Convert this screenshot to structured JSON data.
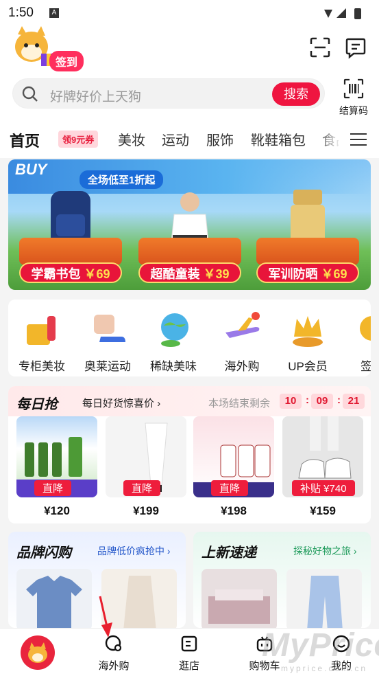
{
  "status": {
    "time": "1:50",
    "notif_letter": "A"
  },
  "header": {
    "signin_label": "签到",
    "search_placeholder": "好牌好价上天狗",
    "search_button": "搜索",
    "settle_label": "结算码"
  },
  "tabs": {
    "active": "首页",
    "coupon": "领9元券",
    "items": [
      "美妆",
      "运动",
      "服饰",
      "靴鞋箱包",
      "食品"
    ]
  },
  "banner": {
    "top_text": "BUY",
    "discount": "全场低至1折起",
    "cards": [
      {
        "label": "学霸书包",
        "price": "￥69"
      },
      {
        "label": "超酷童装",
        "price": "￥39"
      },
      {
        "label": "军训防晒",
        "price": "￥69"
      }
    ]
  },
  "categories": [
    "专柜美妆",
    "奥莱运动",
    "稀缺美味",
    "海外购",
    "UP会员",
    "签到"
  ],
  "flash": {
    "logo": "每日抢",
    "daily": "每日好货惊喜价",
    "ends": "本场结束剩余",
    "countdown": [
      "10",
      "09",
      "21"
    ],
    "products": [
      {
        "badge": "直降",
        "price": "¥120",
        "color": "#4f9a3c"
      },
      {
        "badge": "直降",
        "price": "¥199",
        "color": "#f2f2f2"
      },
      {
        "badge": "直降",
        "price": "¥198",
        "color": "#f9dbe0"
      },
      {
        "badge": "补贴 ¥740",
        "price": "¥159",
        "color": "#d9d9d9"
      }
    ]
  },
  "brand": {
    "title": "品牌闪购",
    "sub": "品牌低价疯抢中"
  },
  "newin": {
    "title": "上新速递",
    "sub": "探秘好物之旅"
  },
  "nav": {
    "items": [
      "海外购",
      "逛店",
      "购物车",
      "我的"
    ]
  },
  "watermark": {
    "text": "MyPrice",
    "sub": "myprice.com.cn"
  }
}
